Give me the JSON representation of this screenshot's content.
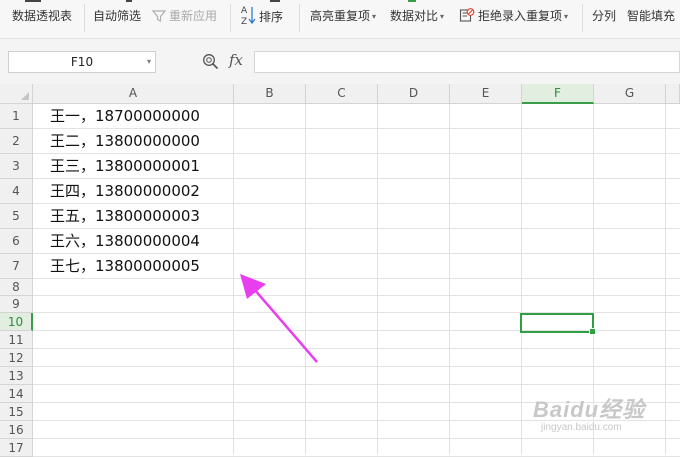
{
  "ribbon": {
    "pivot": "数据透视表",
    "autofilter": "自动筛选",
    "reapply": "重新应用",
    "sort": "排序",
    "highlight_dup": "高亮重复项",
    "data_compare": "数据对比",
    "reject_dup": "拒绝录入重复项",
    "split": "分列",
    "smart_fill": "智能填充"
  },
  "formula_bar": {
    "name_box": "F10",
    "fx": "fx",
    "formula": ""
  },
  "columns": [
    "A",
    "B",
    "C",
    "D",
    "E",
    "F",
    "G"
  ],
  "selected_column": "F",
  "rows": [
    "1",
    "2",
    "3",
    "4",
    "5",
    "6",
    "7",
    "8",
    "9",
    "10",
    "11",
    "12",
    "13",
    "14",
    "15",
    "16",
    "17"
  ],
  "selected_row": "10",
  "cells_a": [
    "王一，18700000000",
    "王二，13800000000",
    "王三，13800000001",
    "王四，13800000002",
    "王五，13800000003",
    "王六，13800000004",
    "王七，13800000005"
  ],
  "annotation": {
    "arrow_color": "#e83ef0"
  },
  "watermark": {
    "logo": "Baidu经验",
    "url": "jingyan.baidu.com"
  },
  "colors": {
    "accent": "#2f9e44"
  }
}
